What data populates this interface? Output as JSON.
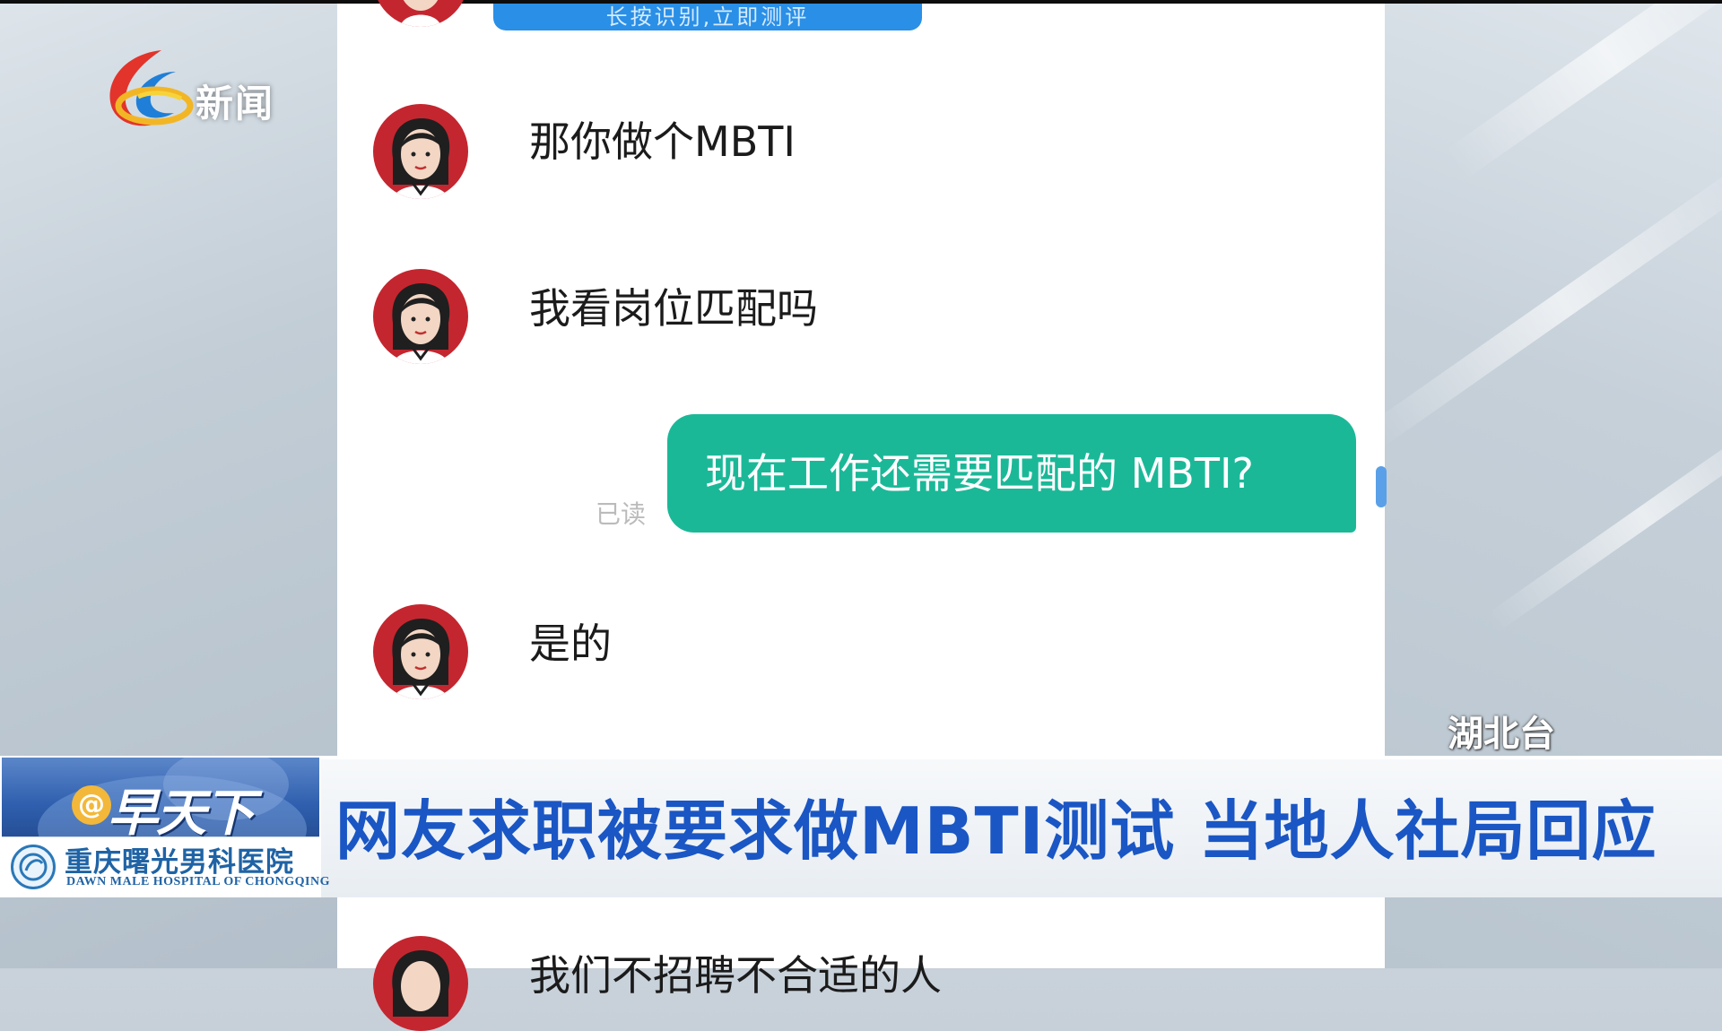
{
  "channel": {
    "logo_text": "新闻",
    "watermark": "湖北台"
  },
  "chat": {
    "top_button_label": "长按识别,立即测评",
    "messages": [
      {
        "from": "recruiter",
        "text": "那你做个MBTI"
      },
      {
        "from": "recruiter",
        "text": "我看岗位匹配吗"
      },
      {
        "from": "user",
        "text": "现在工作还需要匹配的 MBTI?",
        "status": "已读"
      },
      {
        "from": "recruiter",
        "text": "是的"
      },
      {
        "from": "recruiter",
        "text": "我们不招聘不合适的人"
      }
    ]
  },
  "lower_third": {
    "show_at": "@",
    "show_name": "早天下",
    "sponsor_cn": "重庆曙光男科医院",
    "sponsor_en": "DAWN MALE HOSPITAL OF CHONGQING",
    "headline": "网友求职被要求做MBTI测试 当地人社局回应"
  },
  "colors": {
    "bubble_user": "#1bb898",
    "headline": "#1a56c4",
    "avatar_red": "#c4262f",
    "top_button": "#2a8fe6"
  },
  "icons": [
    "channel-logo-icon",
    "avatar-icon",
    "hospital-logo-icon"
  ]
}
